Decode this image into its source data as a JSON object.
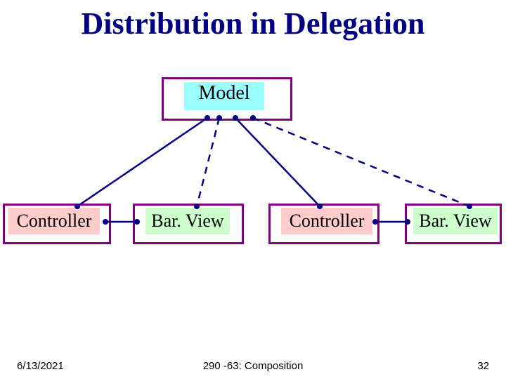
{
  "title": "Distribution in Delegation",
  "nodes": {
    "model": "Model",
    "controller1": "Controller",
    "barview1": "Bar. View",
    "controller2": "Controller",
    "barview2": "Bar. View"
  },
  "footer": {
    "date": "6/13/2021",
    "center": "290 -63: Composition",
    "page": "32"
  },
  "colors": {
    "border": "#800080",
    "title": "#000080",
    "model_fill": "#99ffff",
    "controller_fill": "#ffcccc",
    "barview_fill": "#ccffcc",
    "line": "#000080"
  },
  "edges": [
    {
      "from": "model",
      "to": "controller1",
      "style": "solid"
    },
    {
      "from": "model",
      "to": "barview1",
      "style": "dashed"
    },
    {
      "from": "model",
      "to": "controller2",
      "style": "solid"
    },
    {
      "from": "model",
      "to": "barview2",
      "style": "dashed"
    },
    {
      "from": "controller1",
      "to": "barview1",
      "style": "solid"
    },
    {
      "from": "controller2",
      "to": "barview2",
      "style": "solid"
    }
  ]
}
